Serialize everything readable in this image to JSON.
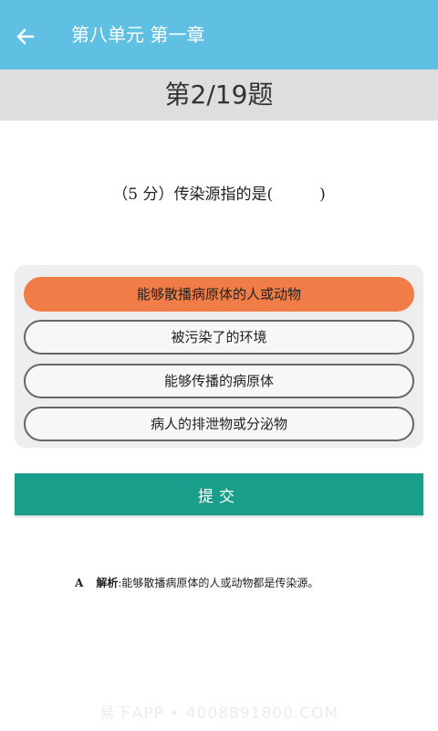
{
  "app_bar": {
    "title": "第八单元 第一章",
    "back_icon": "arrow-left-icon",
    "background": "#5fc0e3"
  },
  "counter": {
    "text": "第2/19题"
  },
  "question": {
    "text": "（5 分）传染源指的是(　　　)"
  },
  "options": [
    {
      "label": "能够散播病原体的人或动物",
      "selected": true
    },
    {
      "label": "被污染了的环境",
      "selected": false
    },
    {
      "label": "能够传播的病原体",
      "selected": false
    },
    {
      "label": "病人的排泄物或分泌物",
      "selected": false
    }
  ],
  "colors": {
    "selected_option": "#f07d47",
    "submit": "#1a9e8c"
  },
  "submit": {
    "label": "提交"
  },
  "analysis": {
    "answer_letter": "A",
    "label": "解析",
    "text": "能够散播病原体的人或动物都是传染源。"
  },
  "watermark": {
    "text": "易下APP • 4008891800.COM"
  }
}
